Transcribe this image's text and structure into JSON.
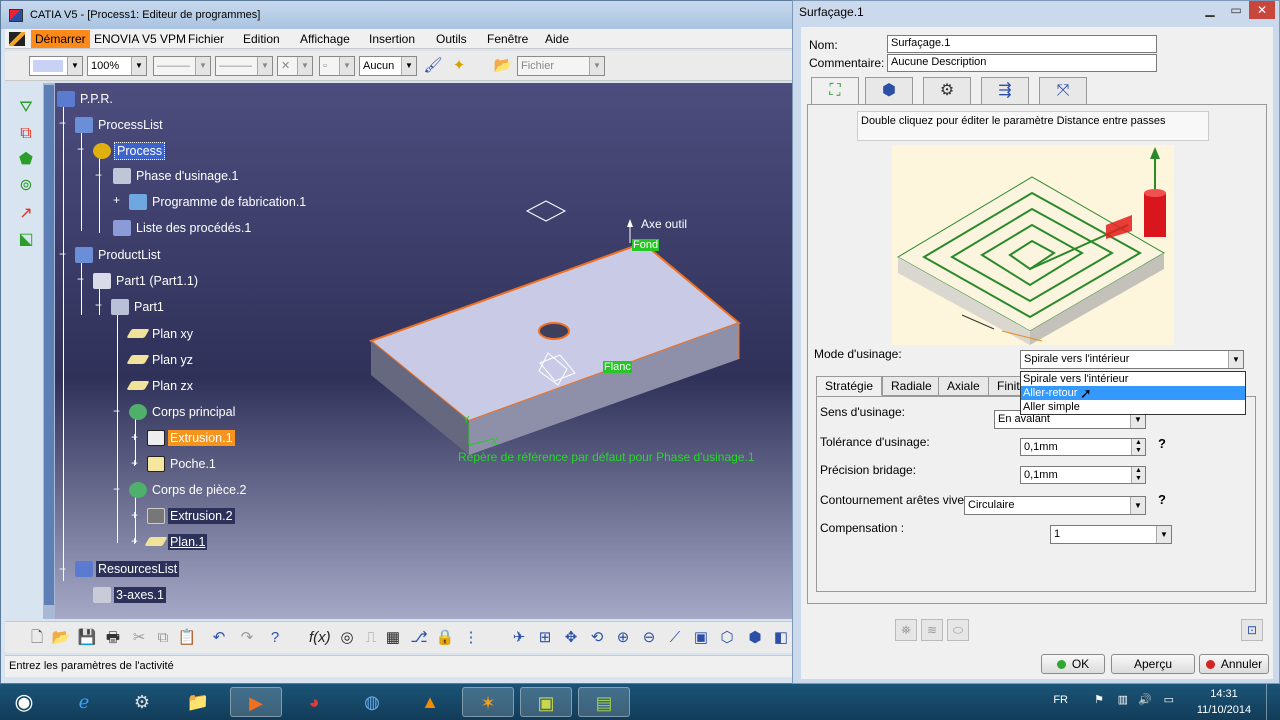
{
  "main_window": {
    "title": "CATIA V5 - [Process1: Editeur de programmes]",
    "menu": [
      "Démarrer",
      "ENOVIA V5 VPM",
      "Fichier",
      "Edition",
      "Affichage",
      "Insertion",
      "Outils",
      "Fenêtre",
      "Aide"
    ],
    "toolbar": {
      "zoom": "100%",
      "layer": "Aucun",
      "file_filter": "Fichier"
    },
    "status_text": "Entrez les paramètres de l'activité"
  },
  "tree": {
    "root": "P.P.R.",
    "process_list": "ProcessList",
    "process": "Process",
    "phase": "Phase d'usinage.1",
    "program": "Programme de fabrication.1",
    "procedures": "Liste des procédés.1",
    "product_list": "ProductList",
    "part_instance": "Part1 (Part1.1)",
    "part": "Part1",
    "plan_xy": "Plan xy",
    "plan_yz": "Plan yz",
    "plan_zx": "Plan zx",
    "body_main": "Corps principal",
    "extrusion1": "Extrusion.1",
    "pocket1": "Poche.1",
    "body_part": "Corps de pièce.2",
    "extrusion2": "Extrusion.2",
    "plan1": "Plan.1",
    "resources_list": "ResourcesList",
    "machine": "3-axes.1"
  },
  "viewport": {
    "axis_label": "Axe outil",
    "bottom_label": "Fond",
    "side_label": "Flanc",
    "reference_label": "Repère de référence par défaut pour Phase d'usinage.1"
  },
  "dialog": {
    "title": "Surfaçage.1",
    "name_label": "Nom:",
    "name_value": "Surfaçage.1",
    "comment_label": "Commentaire:",
    "comment_value": "Aucune Description",
    "hint": "Double cliquez pour éditer le paramètre Distance entre passes",
    "mode_label": "Mode d'usinage:",
    "mode_value": "Spirale vers l'intérieur",
    "mode_options": [
      "Spirale vers l'intérieur",
      "Aller-retour",
      "Aller simple"
    ],
    "mode_highlighted": "Aller-retour",
    "subtabs": [
      "Stratégie",
      "Radiale",
      "Axiale",
      "Finit"
    ],
    "direction_label": "Sens d'usinage:",
    "direction_value": "En avalant",
    "tolerance_label": "Tolérance d'usinage:",
    "tolerance_value": "0,1mm",
    "clamp_label": "Précision bridage:",
    "clamp_value": "0,1mm",
    "edges_label": "Contournement arêtes vives:",
    "edges_value": "Circulaire",
    "compensation_label": "Compensation  :",
    "compensation_value": "1",
    "help": "?",
    "ok": "OK",
    "preview": "Aperçu",
    "cancel": "Annuler"
  },
  "taskbar": {
    "lang": "FR",
    "time": "14:31",
    "date": "11/10/2014"
  }
}
